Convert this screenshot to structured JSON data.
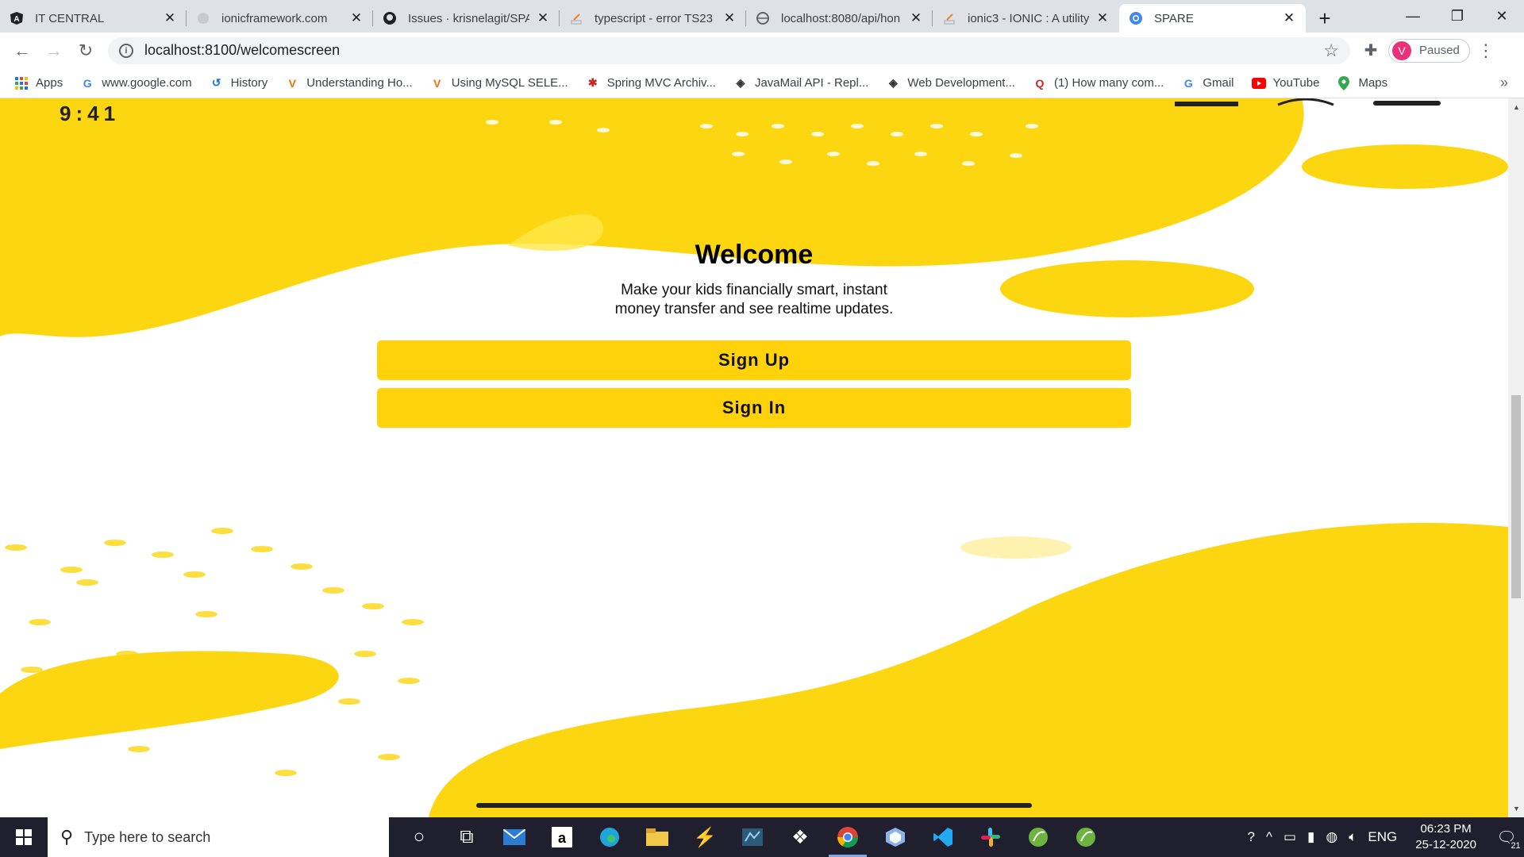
{
  "browser": {
    "tabs": [
      {
        "title": "IT CENTRAL",
        "icon": "angular-icon"
      },
      {
        "title": "ionicframework.com",
        "icon": "globe-icon"
      },
      {
        "title": "Issues · krisnelagit/SPA",
        "icon": "github-icon"
      },
      {
        "title": "typescript - error TS23",
        "icon": "stackoverflow-icon"
      },
      {
        "title": "localhost:8080/api/hon",
        "icon": "globe-icon"
      },
      {
        "title": "ionic3 - IONIC : A utility",
        "icon": "stackoverflow-icon"
      },
      {
        "title": "SPARE",
        "icon": "chrome-icon"
      }
    ],
    "active_tab": 6,
    "address": "localhost:8100/welcomescreen",
    "profile_label": "Paused",
    "profile_initial": "V",
    "bookmarks": [
      {
        "label": "Apps",
        "icon": "apps-grid-icon"
      },
      {
        "label": "www.google.com",
        "icon": "google-icon"
      },
      {
        "label": "History",
        "icon": "history-icon"
      },
      {
        "label": "Understanding Ho...",
        "icon": "gmail-like-icon"
      },
      {
        "label": "Using MySQL SELE...",
        "icon": "gmail-like-icon"
      },
      {
        "label": "Spring MVC Archiv...",
        "icon": "spider-icon"
      },
      {
        "label": "JavaMail API - Repl...",
        "icon": "diamond-icon"
      },
      {
        "label": "Web Development...",
        "icon": "diamond-icon"
      },
      {
        "label": "(1) How many com...",
        "icon": "quora-icon"
      },
      {
        "label": "Gmail",
        "icon": "google-icon"
      },
      {
        "label": "YouTube",
        "icon": "youtube-icon"
      },
      {
        "label": "Maps",
        "icon": "maps-icon"
      }
    ]
  },
  "page": {
    "mock_time": "9:41",
    "welcome_title": "Welcome",
    "subtitle": "Make your kids financially smart, instant\nmoney transfer and see realtime updates.",
    "signup_label": "Sign Up",
    "signin_label": "Sign In",
    "accent": "#ffd20a"
  },
  "taskbar": {
    "search_placeholder": "Type here to search",
    "language": "ENG",
    "time": "06:23 PM",
    "date": "25-12-2020",
    "notification_count": "21"
  }
}
